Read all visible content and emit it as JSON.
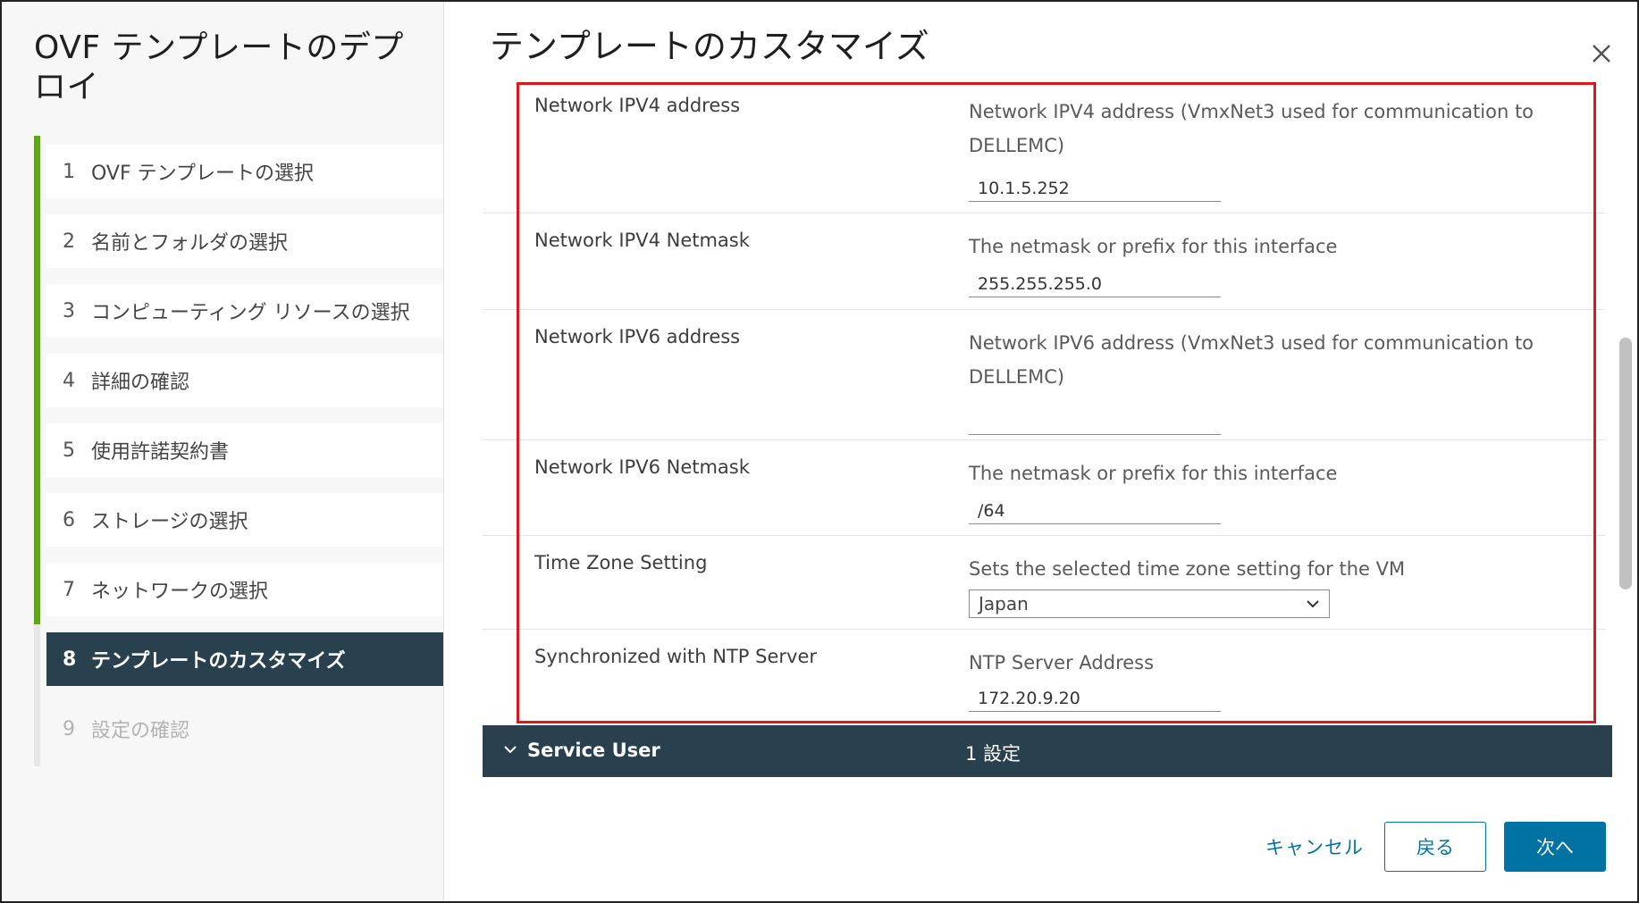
{
  "sidebar": {
    "title": "OVF テンプレートのデプロイ",
    "steps": [
      {
        "num": "1",
        "label": "OVF テンプレートの選択"
      },
      {
        "num": "2",
        "label": "名前とフォルダの選択"
      },
      {
        "num": "3",
        "label": "コンピューティング リソースの選択"
      },
      {
        "num": "4",
        "label": "詳細の確認"
      },
      {
        "num": "5",
        "label": "使用許諾契約書"
      },
      {
        "num": "6",
        "label": "ストレージの選択"
      },
      {
        "num": "7",
        "label": "ネットワークの選択"
      },
      {
        "num": "8",
        "label": "テンプレートのカスタマイズ"
      },
      {
        "num": "9",
        "label": "設定の確認"
      }
    ]
  },
  "main": {
    "title": "テンプレートのカスタマイズ",
    "rows": [
      {
        "label": "Network IPV4 address",
        "description": "Network IPV4 address (VmxNet3 used for communication to DELLEMC)",
        "value": "10.1.5.252"
      },
      {
        "label": "Network IPV4 Netmask",
        "description": "The netmask or prefix for this interface",
        "value": "255.255.255.0"
      },
      {
        "label": "Network IPV6 address",
        "description": "Network IPV6 address (VmxNet3 used for communication to DELLEMC)",
        "value": ""
      },
      {
        "label": "Network IPV6 Netmask",
        "description": "The netmask or prefix for this interface",
        "value": "/64"
      },
      {
        "label": "Time Zone Setting",
        "description": "Sets the selected time zone setting for the VM",
        "value": "Japan"
      },
      {
        "label": "Synchronized with NTP Server",
        "description": "NTP Server Address",
        "value": "172.20.9.20"
      }
    ],
    "section": {
      "title": "Service User",
      "count": "1 設定"
    }
  },
  "footer": {
    "cancel": "キャンセル",
    "back": "戻る",
    "next": "次へ"
  },
  "colors": {
    "accent": "#0072a3",
    "active_step": "#29404f",
    "progress": "#62a420",
    "highlight": "#e0161d"
  }
}
